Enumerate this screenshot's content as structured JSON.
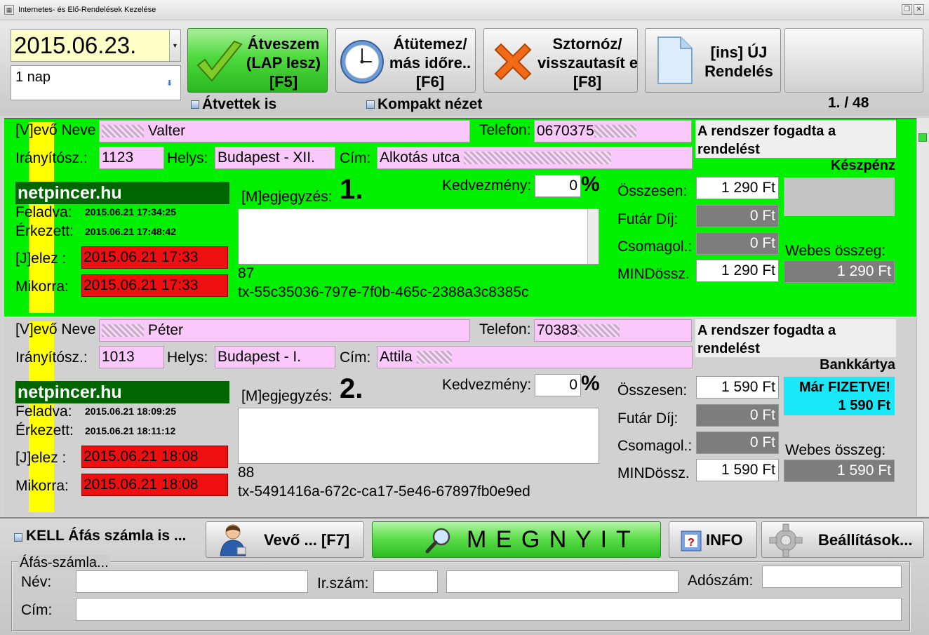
{
  "window": {
    "title": "Internetes- és Elő-Rendelések Kezelése",
    "app_icon": "app-icon",
    "restore_glyph": "❐",
    "close_glyph": "✕"
  },
  "toolbar": {
    "date": "2015.06.23.",
    "days": "1 nap",
    "btn_accept": "Átveszem\n(LAP lesz)\n[F5]",
    "btn_reschedule": "Átütemez/\nmás időre..\n[F6]",
    "btn_cancel": "Sztornóz/\nvisszautasít e",
    "btn_cancel_key": "[F8]",
    "btn_new": "[ins] ÚJ\nRendelés",
    "chk_taken": "Átvettek is",
    "chk_compact": "Kompakt nézet",
    "pager": "1. / 48"
  },
  "labels": {
    "customer_name": "[V]evő Neve",
    "phone": "Telefon:",
    "zip": "Irányítósz.:",
    "city": "Helys:",
    "address": "Cím:",
    "note": "[M]egjegyzés:",
    "discount": "Kedvezmény:",
    "percent": "%",
    "sent": "Feladva:",
    "arrived": "Érkezett:",
    "signal": "[J]elez :",
    "when": "Mikorra:",
    "total": "Összesen:",
    "courier": "Futár Díj:",
    "packaging": "Csomagol.:",
    "grand_total": "MINDössz.",
    "web_amount": "Webes összeg:"
  },
  "orders": [
    {
      "name": "Valter",
      "phone": "0670375",
      "zip": "1123",
      "city": "Budapest - XII.",
      "address": "Alkotás utca",
      "source": "netpincer.hu",
      "sent": "2015.06.21 17:34:25",
      "arrived": "2015.06.21 17:48:42",
      "signal": "2015.06.21 17:33",
      "when": "2015.06.21 17:33",
      "number": "1.",
      "discount": "0",
      "ref_num": "87",
      "tx": "tx-55c35036-797e-7f0b-465c-2388a3c8385c",
      "status": "A rendszer fogadta a rendelést",
      "payment_type": "Készpénz",
      "paid_text": "",
      "total": "1 290 Ft",
      "courier": "0 Ft",
      "packaging": "0 Ft",
      "grand_total": "1 290 Ft",
      "web_amount": "1 290 Ft"
    },
    {
      "name": "Péter",
      "phone": "70383",
      "zip": "1013",
      "city": "Budapest - I.",
      "address": "Attila",
      "source": "netpincer.hu",
      "sent": "2015.06.21 18:09:25",
      "arrived": "2015.06.21 18:11:12",
      "signal": "2015.06.21 18:08",
      "when": "2015.06.21 18:08",
      "number": "2.",
      "discount": "0",
      "ref_num": "88",
      "tx": "tx-5491416a-672c-ca17-5e46-67897fb0e9ed",
      "status": "A rendszer fogadta a rendelést",
      "payment_type": "Bankkártya",
      "paid_text": "Már FIZETVE!",
      "paid_amount": "1 590 Ft",
      "total": "1 590 Ft",
      "courier": "0 Ft",
      "packaging": "0 Ft",
      "grand_total": "1 590 Ft",
      "web_amount": "1 590 Ft"
    }
  ],
  "bottom": {
    "chk_vat": "KELL Áfás számla is ...",
    "btn_customer": "Vevő ... [F7]",
    "btn_open": "M E G N Y I T",
    "btn_info": "INFO",
    "btn_settings": "Beállítások...",
    "vat_legend": "Áfás-számla...",
    "lbl_name": "Név:",
    "lbl_zip": "Ir.szám:",
    "lbl_taxnum": "Adószám:",
    "lbl_address": "Cím:"
  },
  "colors": {
    "active_order_bg": "#00f000",
    "inactive_order_bg": "#d1d1d1",
    "field_bg": "#fbc8fb",
    "date_bg": "#ffffc8",
    "source_bg": "#006600",
    "alert_red": "#ee1010",
    "paid_cyan": "#18e8f8"
  }
}
